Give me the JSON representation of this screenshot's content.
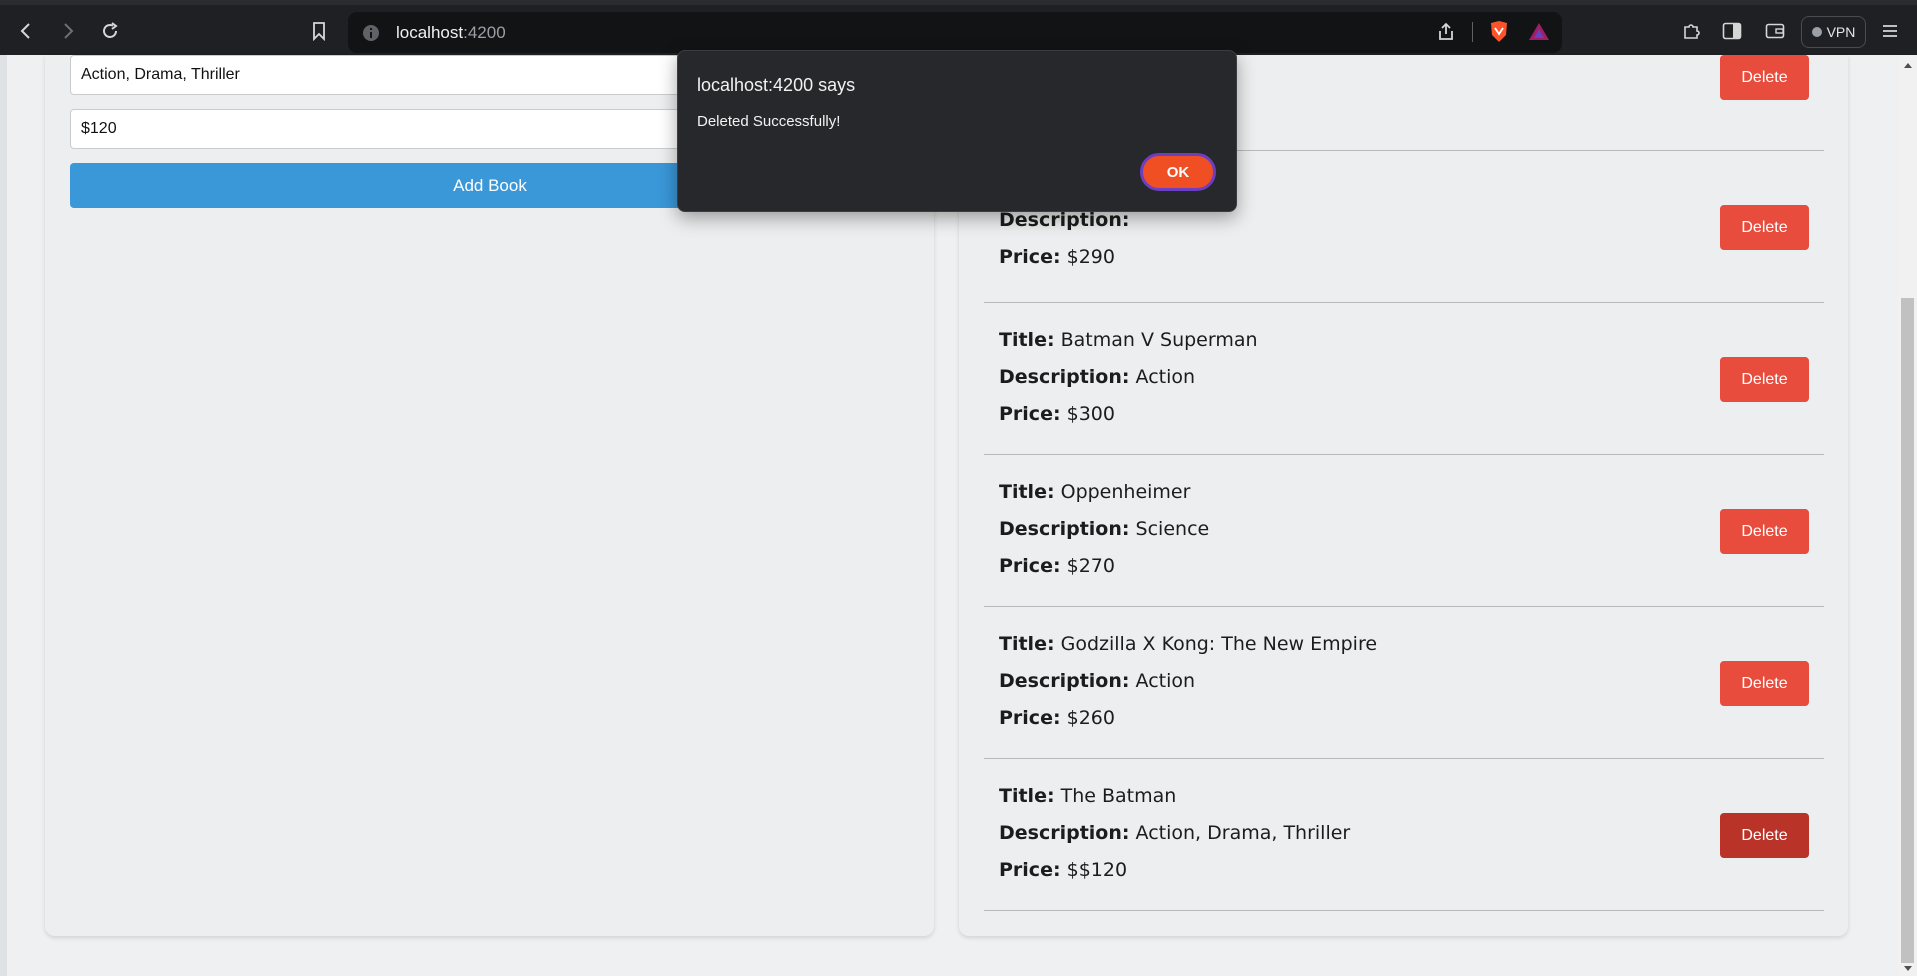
{
  "browser": {
    "url_host": "localhost",
    "url_port": ":4200",
    "vpn_label": "VPN"
  },
  "form": {
    "description_value": "Action, Drama, Thriller",
    "price_value": "$120",
    "add_button_label": "Add Book"
  },
  "labels": {
    "title": "Title:",
    "description": "Description:",
    "price": "Price:",
    "delete": "Delete"
  },
  "partial_book": {
    "description": "",
    "price": "$290"
  },
  "books": [
    {
      "title": "Batman V Superman",
      "description": "Action",
      "price": "$300"
    },
    {
      "title": "Oppenheimer",
      "description": "Science",
      "price": "$270"
    },
    {
      "title": "Godzilla X Kong: The New Empire",
      "description": "Action",
      "price": "$260"
    },
    {
      "title": "The Batman",
      "description": "Action, Drama, Thriller",
      "price": "$$120"
    }
  ],
  "dialog": {
    "title": "localhost:4200 says",
    "message": "Deleted Successfully!",
    "ok_label": "OK"
  },
  "colors": {
    "add_button": "#3a97d8",
    "delete_button": "#e74c3c",
    "delete_button_active": "#b93328",
    "ok_button": "#f04e23"
  }
}
